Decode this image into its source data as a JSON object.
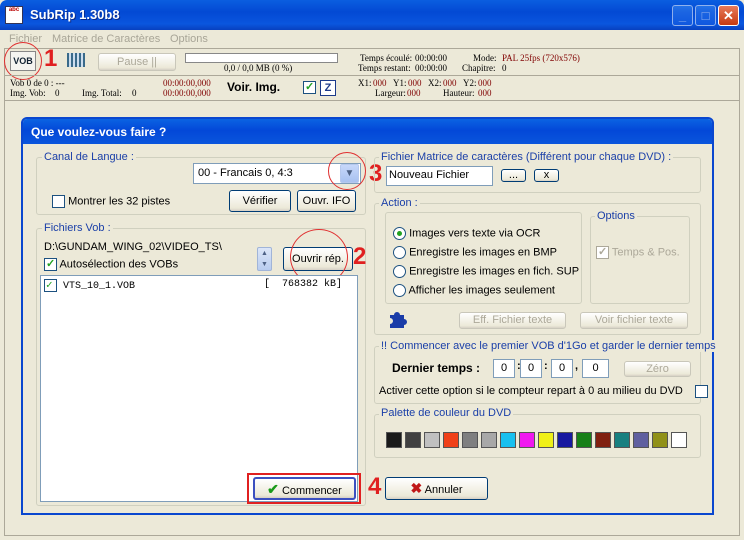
{
  "window": {
    "title": "SubRip 1.30b8",
    "icon_text": "abc"
  },
  "menu": [
    "Fichier",
    "Matrice de Caractères",
    "Options"
  ],
  "toolbar": {
    "vob_button": "VOB",
    "pause_label": "Pause ||",
    "progress_text": "0,0 / 0,0 MB (0 %)",
    "progress_fraction": 0,
    "temps_ecoule_label": "Temps écoulé:",
    "temps_ecoule_value": "00:00:00",
    "temps_restant_label": "Temps restant:",
    "temps_restant_value": "00:00:00",
    "mode_label": "Mode:",
    "mode_value": "PAL 25fps (720x576)",
    "chapitre_label": "Chapitre:",
    "chapitre_value": "0",
    "vob_label": "Vob 0  de 0  :  ---",
    "img_vob_label": "Img. Vob:",
    "img_vob_value": "0",
    "img_total_label": "Img. Total:",
    "img_total_value": "0",
    "time1": "00:00:00,000",
    "time2": "00:00:00,000",
    "voir_img": "Voir. Img.",
    "z_button": "Z",
    "x1_label": "X1:",
    "x1": "000",
    "y1_label": "Y1:",
    "y1": "000",
    "x2_label": "X2:",
    "x2": "000",
    "y2_label": "Y2:",
    "y2": "000",
    "largeur_label": "Largeur:",
    "largeur": "000",
    "hauteur_label": "Hauteur:",
    "hauteur": "000"
  },
  "dialog": {
    "title": "Que voulez-vous faire ?",
    "canal": {
      "label": "Canal de Langue :",
      "selected": "00 - Francais 0, 4:3",
      "show32": "Montrer les 32 pistes",
      "verifier": "Vérifier",
      "ouvr_ifo": "Ouvr. IFO"
    },
    "fichiers": {
      "label": "Fichiers Vob :",
      "path": "D:\\GUNDAM_WING_02\\VIDEO_TS\\",
      "autoselect": "Autosélection des VOBs",
      "ouvrir": "Ouvrir rép.",
      "items": [
        {
          "name": "VTS_10_1.VOB",
          "size": "[  768382 kB]"
        }
      ]
    },
    "matrice": {
      "label": "Fichier Matrice de caractères (Différent pour chaque DVD) :",
      "value": "Nouveau Fichier",
      "browse": "...",
      "clear": "x"
    },
    "action": {
      "label": "Action :",
      "options": [
        "Images vers texte via OCR",
        "Enregistre les images en BMP",
        "Enregistre les images en fich. SUP",
        "Afficher les images seulement"
      ],
      "selected_index": 0,
      "eff": "Eff. Fichier texte",
      "voir": "Voir fichier texte"
    },
    "options": {
      "label": "Options",
      "temps_pos": "Temps & Pos."
    },
    "commencer_vob": {
      "label": "!! Commencer avec le premier VOB d'1Go et garder le dernier temps",
      "dernier_temps": "Dernier temps :",
      "fields": [
        "0",
        "0",
        "0",
        "0"
      ],
      "zero": "Zéro",
      "note": "Activer cette option si le compteur repart à 0 au milieu du DVD"
    },
    "palette": {
      "label": "Palette de couleur du DVD",
      "colors": [
        "#1a1a1a",
        "#404040",
        "#c0c0c0",
        "#f04018",
        "#808080",
        "#a8a8a8",
        "#18c0f0",
        "#f018f0",
        "#f0f018",
        "#1818a0",
        "#188018",
        "#802010",
        "#188080",
        "#6060a0",
        "#909018",
        "#ffffff"
      ]
    },
    "commencer": "Commencer",
    "annuler": "Annuler"
  },
  "annotations": [
    "1",
    "2",
    "3",
    "4"
  ]
}
